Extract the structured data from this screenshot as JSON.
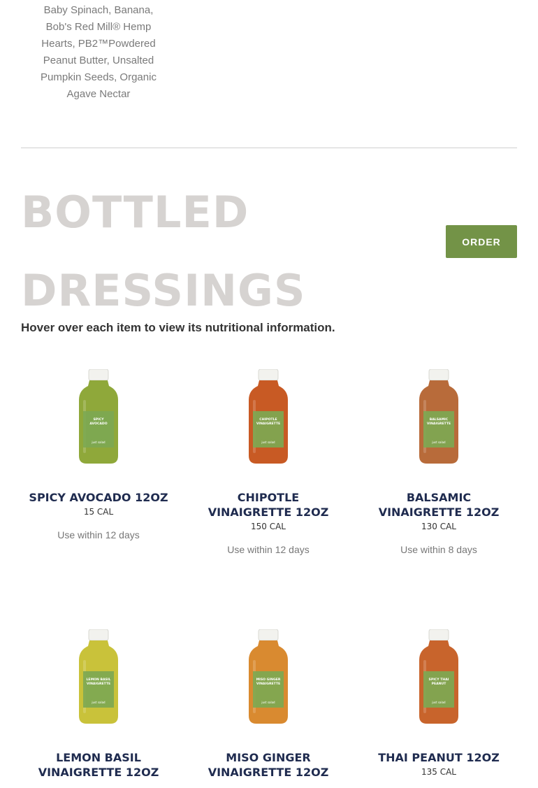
{
  "top_card": {
    "ingredients": "Baby Spinach, Banana, Bob's Red Mill® Hemp Hearts, PB2™Powdered Peanut Butter, Unsalted Pumpkin Seeds, Organic Agave Nectar"
  },
  "section": {
    "title_line1": "BOTTLED",
    "title_line2": "DRESSINGS",
    "order_label": "ORDER",
    "hover_note": "Hover over each item to view its nutritional information."
  },
  "colors": {
    "accent_green": "#739347",
    "title_gray": "#d6d3d1",
    "name_navy": "#1f2b4f"
  },
  "products": [
    {
      "name": "SPICY AVOCADO 12OZ",
      "calories": "15 CAL",
      "use_within": "Use within 12 days",
      "bottle_color": "#8fa83a",
      "label_text": "SPICY AVOCADO"
    },
    {
      "name": "CHIPOTLE VINAIGRETTE 12OZ",
      "calories": "150 CAL",
      "use_within": "Use within 12 days",
      "bottle_color": "#c85a24",
      "label_text": "CHIPOTLE VINAIGRETTE"
    },
    {
      "name": "BALSAMIC VINAIGRETTE 12OZ",
      "calories": "130 CAL",
      "use_within": "Use within 8 days",
      "bottle_color": "#b86b3a",
      "label_text": "BALSAMIC VINAIGRETTE"
    },
    {
      "name": "LEMON BASIL VINAIGRETTE 12OZ",
      "calories": "",
      "use_within": "",
      "bottle_color": "#c9c23a",
      "label_text": "LEMON BASIL VINAIGRETTE"
    },
    {
      "name": "MISO GINGER VINAIGRETTE 12OZ",
      "calories": "",
      "use_within": "",
      "bottle_color": "#d98a30",
      "label_text": "MISO GINGER VINAIGRETTE"
    },
    {
      "name": "THAI PEANUT 12OZ",
      "calories": "135 CAL",
      "use_within": "",
      "bottle_color": "#c8642c",
      "label_text": "SPICY THAI PEANUT"
    }
  ],
  "brand_label": "just salad"
}
